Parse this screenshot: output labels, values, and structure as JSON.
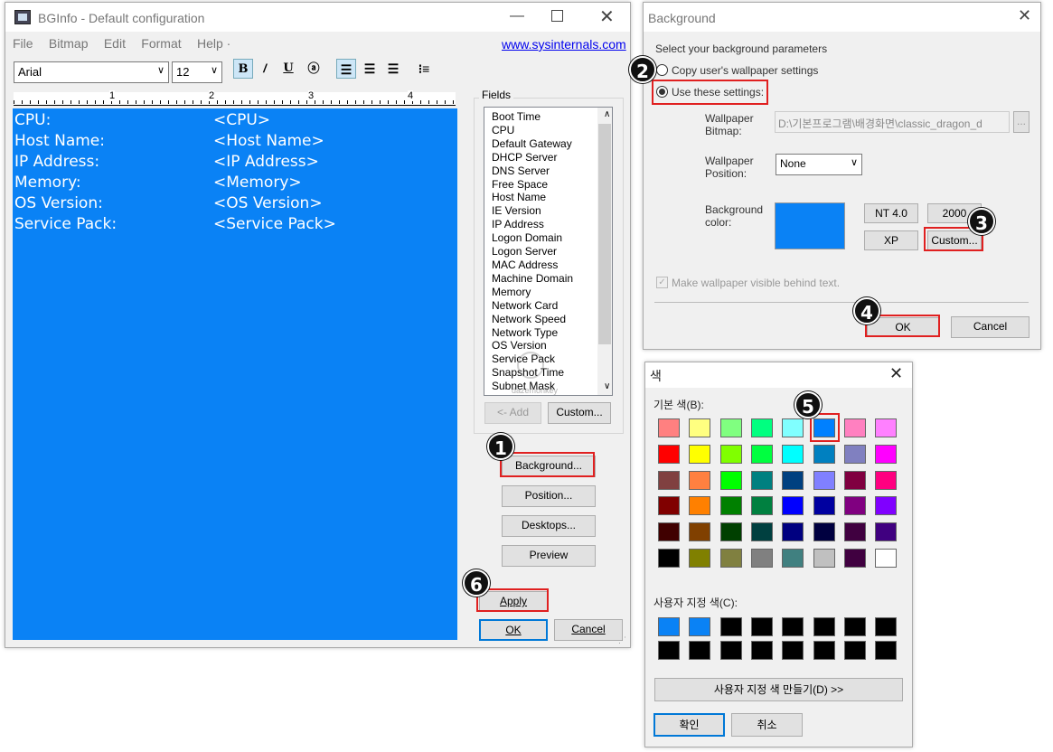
{
  "bginfo": {
    "title": "BGInfo - Default configuration",
    "menu": [
      "File",
      "Bitmap",
      "Edit",
      "Format",
      "Help ·"
    ],
    "link": "www.sysinternals.com",
    "font": "Arial",
    "size": "12",
    "ruler_marks": [
      "1",
      "2",
      "3",
      "4"
    ],
    "rows": [
      {
        "label": "CPU:",
        "value": "<CPU>"
      },
      {
        "label": "Host Name:",
        "value": "<Host Name>"
      },
      {
        "label": "IP Address:",
        "value": "<IP Address>"
      },
      {
        "label": "Memory:",
        "value": "<Memory>"
      },
      {
        "label": "OS Version:",
        "value": "<OS Version>"
      },
      {
        "label": "Service Pack:",
        "value": "<Service Pack>"
      }
    ],
    "fields_label": "Fields",
    "fields": [
      "Boot Time",
      "CPU",
      "Default Gateway",
      "DHCP Server",
      "DNS Server",
      "Free Space",
      "Host Name",
      "IE Version",
      "IP Address",
      "Logon Domain",
      "Logon Server",
      "MAC Address",
      "Machine Domain",
      "Memory",
      "Network Card",
      "Network Speed",
      "Network Type",
      "OS Version",
      "Service Pack",
      "Snapshot Time",
      "Subnet Mask"
    ],
    "add_label": "<- Add",
    "custom_label": "Custom...",
    "background_label": "Background...",
    "position_label": "Position...",
    "desktops_label": "Desktops...",
    "preview_label": "Preview",
    "apply_label": "Apply",
    "ok_label": "OK",
    "cancel_label": "Cancel",
    "watermark": "dazemonkey"
  },
  "background": {
    "title": "Background",
    "heading": "Select your background parameters",
    "copy_option": "Copy user's wallpaper settings",
    "use_option": "Use these settings:",
    "wallpaper_bitmap_label": "Wallpaper\nBitmap:",
    "wallpaper_bitmap_value": "D:\\기본프로그램\\배경화면\\classic_dragon_d",
    "browse": "...",
    "wallpaper_position_label": "Wallpaper\nPosition:",
    "wallpaper_position_value": "None",
    "bg_color_label": "Background\ncolor:",
    "bg_color": "#0a82f5",
    "nt40": "NT 4.0",
    "y2000": "2000",
    "xp": "XP",
    "custom": "Custom...",
    "visible_checkbox": "Make wallpaper visible behind text.",
    "ok": "OK",
    "cancel": "Cancel"
  },
  "color_dialog": {
    "title": "색",
    "basic_label": "기본 색(B):",
    "custom_label": "사용자 지정 색(C):",
    "define_custom": "사용자 지정 색 만들기(D) >>",
    "ok": "확인",
    "cancel": "취소",
    "basic_colors": [
      [
        "#ff8080",
        "#ffff80",
        "#80ff80",
        "#00ff80",
        "#80ffff",
        "#0080ff",
        "#ff80c0",
        "#ff80ff"
      ],
      [
        "#ff0000",
        "#ffff00",
        "#80ff00",
        "#00ff40",
        "#00ffff",
        "#0080c0",
        "#8080c0",
        "#ff00ff"
      ],
      [
        "#804040",
        "#ff8040",
        "#00ff00",
        "#008080",
        "#004080",
        "#8080ff",
        "#800040",
        "#ff0080"
      ],
      [
        "#800000",
        "#ff8000",
        "#008000",
        "#008040",
        "#0000ff",
        "#0000a0",
        "#800080",
        "#8000ff"
      ],
      [
        "#400000",
        "#804000",
        "#004000",
        "#004040",
        "#000080",
        "#000040",
        "#400040",
        "#400080"
      ],
      [
        "#000000",
        "#808000",
        "#808040",
        "#808080",
        "#408080",
        "#c0c0c0",
        "#400040",
        "#ffffff"
      ]
    ],
    "custom_colors": [
      [
        "#0a82f5",
        "#0a82f5",
        "#000000",
        "#000000",
        "#000000",
        "#000000",
        "#000000",
        "#000000"
      ],
      [
        "#000000",
        "#000000",
        "#000000",
        "#000000",
        "#000000",
        "#000000",
        "#000000",
        "#000000"
      ]
    ]
  },
  "steps": [
    "1",
    "2",
    "3",
    "4",
    "5",
    "6"
  ]
}
